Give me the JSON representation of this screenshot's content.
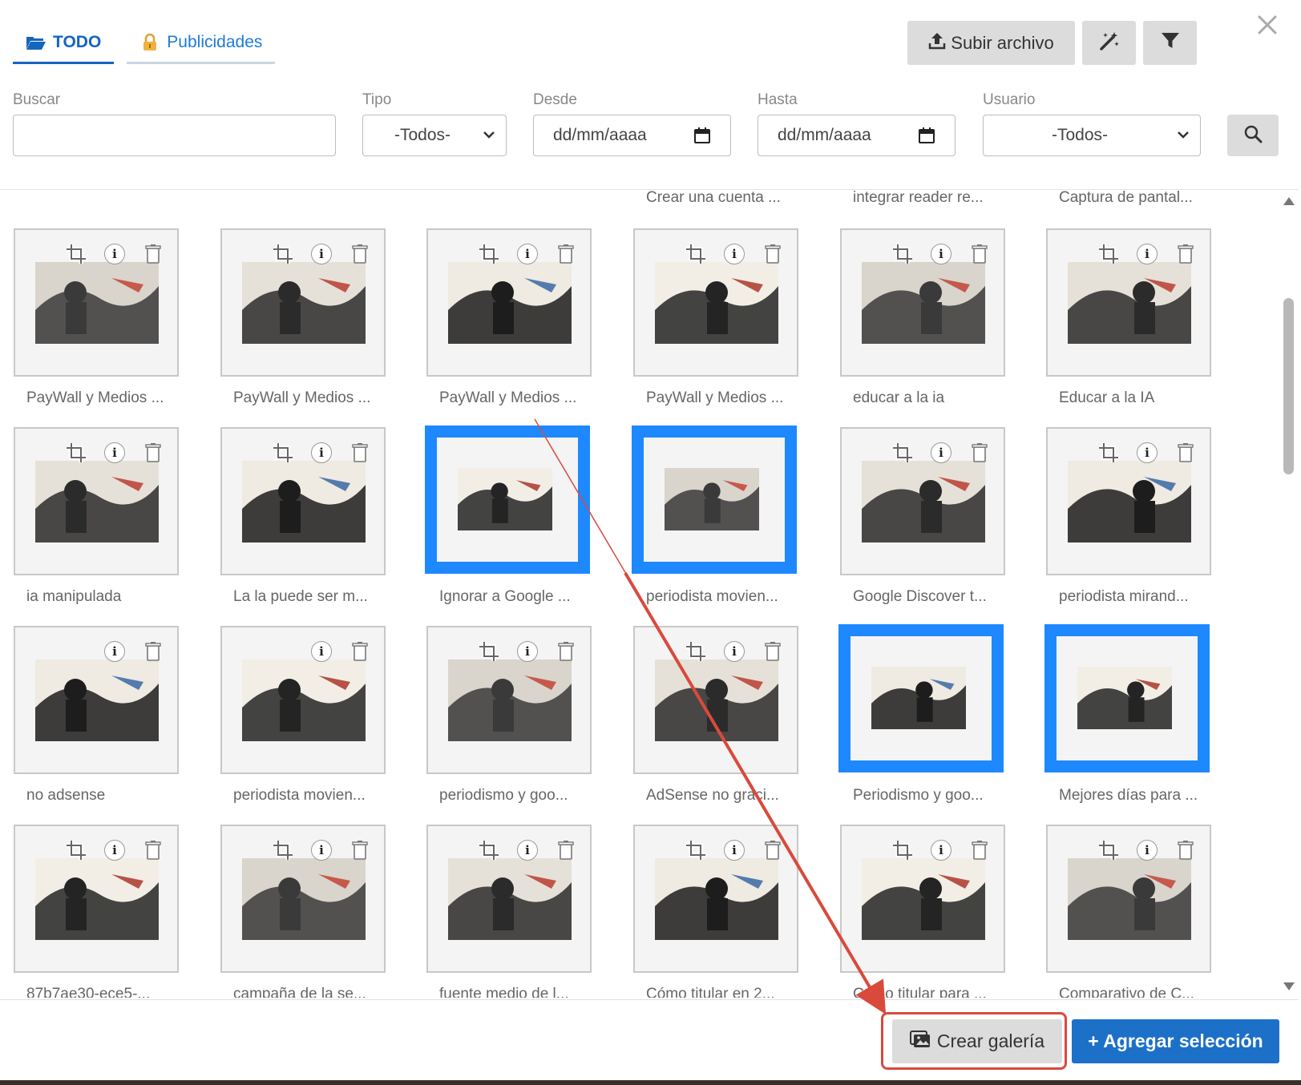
{
  "tabs": [
    {
      "label": "TODO",
      "icon": "folder-open-icon",
      "active": true
    },
    {
      "label": "Publicidades",
      "icon": "lock-icon",
      "active": false
    }
  ],
  "toolbar": {
    "upload_label": "Subir archivo",
    "upload_icon": "upload-icon",
    "magic_icon": "magic-wand-icon",
    "filter_icon": "filter-icon",
    "close_icon": "close-icon"
  },
  "filters": {
    "search": {
      "label": "Buscar",
      "value": ""
    },
    "tipo": {
      "label": "Tipo",
      "value": "-Todos-"
    },
    "desde": {
      "label": "Desde",
      "value": "dd/mm/aaaa"
    },
    "hasta": {
      "label": "Hasta",
      "value": "dd/mm/aaaa"
    },
    "usuario": {
      "label": "Usuario",
      "value": "-Todos-"
    }
  },
  "top_captions": [
    "Crear una cuenta ...",
    "integrar reader re...",
    "Captura de pantal..."
  ],
  "rows": [
    [
      {
        "caption": "PayWall y Medios ...",
        "selected": false,
        "crop": true
      },
      {
        "caption": "PayWall y Medios ...",
        "selected": false,
        "crop": true
      },
      {
        "caption": "PayWall y Medios ...",
        "selected": false,
        "crop": true
      },
      {
        "caption": "PayWall y Medios ...",
        "selected": false,
        "crop": true
      },
      {
        "caption": "educar a la ia",
        "selected": false,
        "crop": true
      },
      {
        "caption": "Educar a la IA",
        "selected": false,
        "crop": true
      }
    ],
    [
      {
        "caption": "ia manipulada",
        "selected": false,
        "crop": true
      },
      {
        "caption": "La la puede ser m...",
        "selected": false,
        "crop": true
      },
      {
        "caption": "Ignorar a Google ...",
        "selected": true,
        "crop": false
      },
      {
        "caption": "periodista movien...",
        "selected": true,
        "crop": false
      },
      {
        "caption": "Google Discover t...",
        "selected": false,
        "crop": true
      },
      {
        "caption": "periodista mirand...",
        "selected": false,
        "crop": true
      }
    ],
    [
      {
        "caption": "no adsense",
        "selected": false,
        "crop": false
      },
      {
        "caption": "periodista movien...",
        "selected": false,
        "crop": false
      },
      {
        "caption": "periodismo y goo...",
        "selected": false,
        "crop": true
      },
      {
        "caption": "AdSense no graci...",
        "selected": false,
        "crop": true
      },
      {
        "caption": "Periodismo y goo...",
        "selected": true,
        "crop": false
      },
      {
        "caption": "Mejores días para ...",
        "selected": true,
        "crop": false
      }
    ],
    [
      {
        "caption": "87b7ae30-ece5-...",
        "selected": false,
        "crop": true
      },
      {
        "caption": "campaña de la se...",
        "selected": false,
        "crop": true
      },
      {
        "caption": "fuente medio de l...",
        "selected": false,
        "crop": true
      },
      {
        "caption": "Cómo titular en 2...",
        "selected": false,
        "crop": true
      },
      {
        "caption": "Cómo titular para ...",
        "selected": false,
        "crop": true
      },
      {
        "caption": "Comparativo de C...",
        "selected": false,
        "crop": true
      }
    ]
  ],
  "footer": {
    "gallery_label": "Crear galería",
    "gallery_icon": "gallery-icon",
    "add_label": "+ Agregar selección"
  },
  "colors": {
    "accent": "#1565c0",
    "selection": "#1e88ff",
    "primary_button": "#1c70c8",
    "annotation": "#d94a3c"
  }
}
